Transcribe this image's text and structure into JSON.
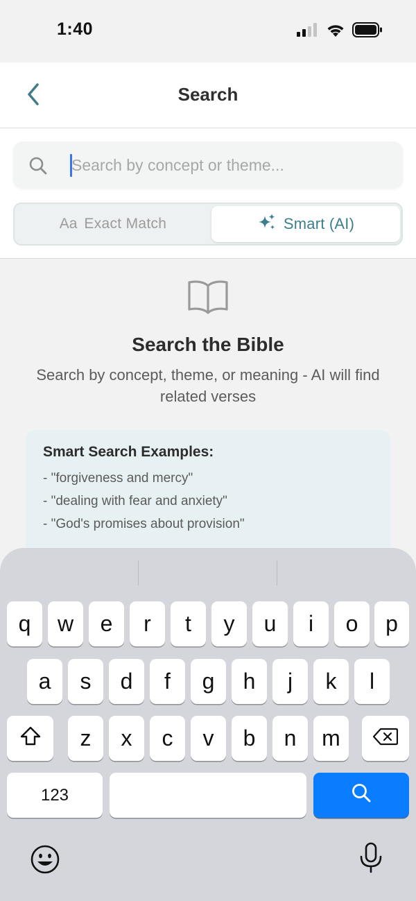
{
  "status_bar": {
    "time": "1:40",
    "icons": [
      "cellular-signal-icon",
      "wifi-icon",
      "battery-icon"
    ]
  },
  "header": {
    "title": "Search",
    "back_icon": "chevron-left-icon"
  },
  "search": {
    "placeholder": "Search by concept or theme...",
    "value": "",
    "icon": "search-icon"
  },
  "mode_toggle": {
    "options": [
      {
        "glyph": "Aa",
        "label": "Exact Match",
        "selected": false
      },
      {
        "icon": "sparkles-icon",
        "label": "Smart (AI)",
        "selected": true
      }
    ]
  },
  "empty_state": {
    "icon": "open-book-icon",
    "title": "Search the Bible",
    "description": "Search by concept, theme, or meaning - AI will find related verses"
  },
  "examples": {
    "title": "Smart Search Examples:",
    "items": [
      "- \"forgiveness and mercy\"",
      "- \"dealing with fear and anxiety\"",
      "- \"God's promises about provision\""
    ]
  },
  "keyboard": {
    "row1": [
      "q",
      "w",
      "e",
      "r",
      "t",
      "y",
      "u",
      "i",
      "o",
      "p"
    ],
    "row2": [
      "a",
      "s",
      "d",
      "f",
      "g",
      "h",
      "j",
      "k",
      "l"
    ],
    "row3": [
      "z",
      "x",
      "c",
      "v",
      "b",
      "n",
      "m"
    ],
    "numbers_label": "123",
    "return_icon": "search-icon",
    "emoji_icon": "emoji-icon",
    "mic_icon": "microphone-icon"
  },
  "colors": {
    "accent": "#3c7f8c",
    "keyboard_return": "#0a7cff",
    "caret": "#3a74f0",
    "examples_background": "#e7f1f3"
  }
}
